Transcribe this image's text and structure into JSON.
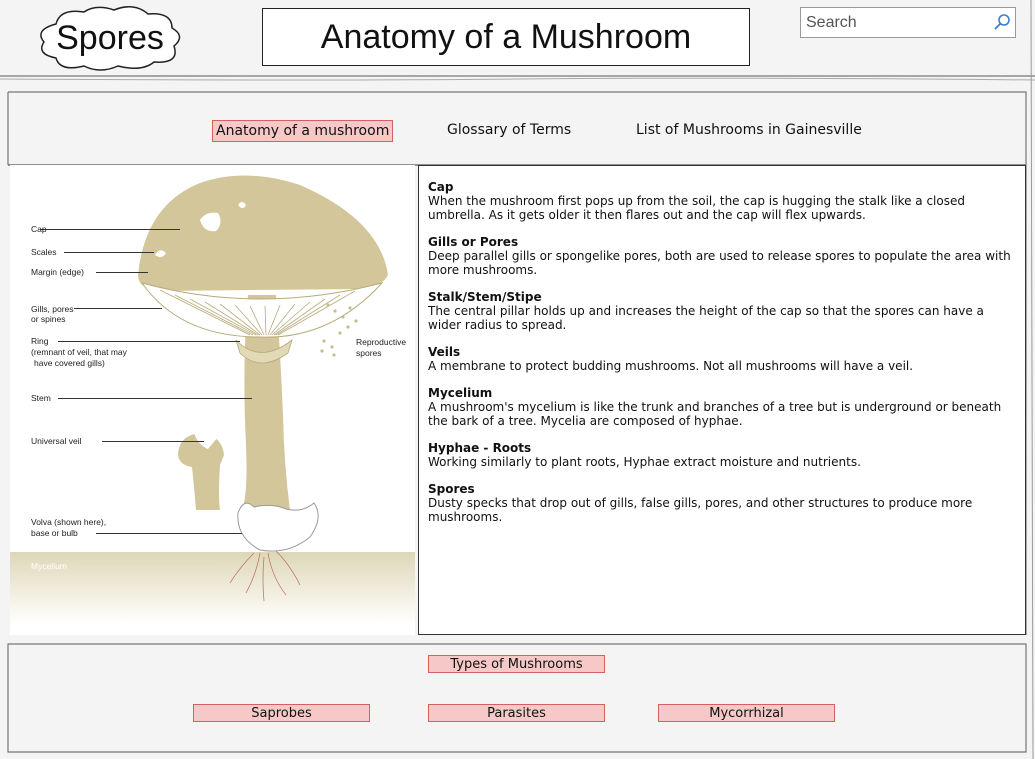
{
  "header": {
    "logo_text": "Spores",
    "page_title": "Anatomy of a Mushroom",
    "search_placeholder": "Search"
  },
  "nav": {
    "items": [
      {
        "label": "Anatomy of a mushroom",
        "active": true
      },
      {
        "label": "Glossary of Terms",
        "active": false
      },
      {
        "label": "List of Mushrooms in Gainesville",
        "active": false
      }
    ]
  },
  "diagram": {
    "labels": {
      "cap": "Cap",
      "scales": "Scales",
      "margin": "Margin (edge)",
      "gills_1": "Gills, pores",
      "gills_2": "or spines",
      "ring_1": "Ring",
      "ring_2": "(remnant of veil, that may",
      "ring_3": "have covered gills)",
      "stem": "Stem",
      "universal_veil": "Universal veil",
      "volva_1": "Volva (shown here),",
      "volva_2": "base or bulb",
      "mycelium": "Mycelium",
      "spores_1": "Reproductive",
      "spores_2": "spores"
    }
  },
  "terms": [
    {
      "title": "Cap",
      "body": "When the mushroom first pops up from the soil, the cap is hugging the stalk like a closed umbrella. As it gets older it then flares out and the cap will flex upwards."
    },
    {
      "title": "Gills or Pores",
      "body": "Deep parallel gills or spongelike pores, both are used to release spores to populate the area with more mushrooms."
    },
    {
      "title": "Stalk/Stem/Stipe",
      "body": "The central pillar holds up and increases the height of the cap so that the spores can have a wider radius to spread."
    },
    {
      "title": "Veils",
      "body": "A membrane to protect budding mushrooms. Not all mushrooms will have a veil."
    },
    {
      "title": "Mycelium",
      "body": "A mushroom's mycelium is like the trunk and branches of a tree but is underground or beneath the bark of a tree. Mycelia are composed of hyphae."
    },
    {
      "title": "Hyphae - Roots",
      "body": "Working similarly to plant roots, Hyphae extract moisture and nutrients."
    },
    {
      "title": "Spores",
      "body": "Dusty specks that drop out of gills, false gills, pores, and other structures to produce more mushrooms."
    }
  ],
  "types": {
    "heading": "Types of Mushrooms",
    "buttons": [
      "Saprobes",
      "Parasites",
      "Mycorrhizal"
    ]
  },
  "colors": {
    "accent_fill": "#f7c8c8",
    "accent_border": "#d46060",
    "mushroom": "#d2c69a"
  }
}
